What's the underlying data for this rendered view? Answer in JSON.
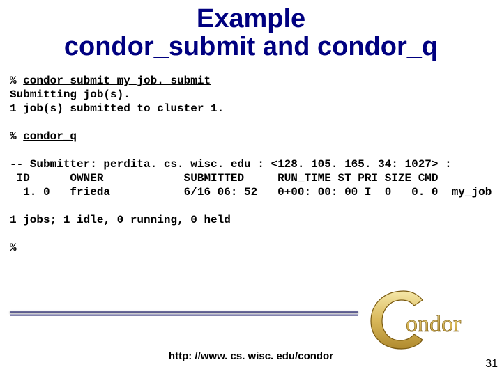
{
  "title_line1": "Example",
  "title_line2": "condor_submit and condor_q",
  "terminal": {
    "prompt1": "% ",
    "cmd1": "condor_submit my_job. submit",
    "out1a": "Submitting job(s).",
    "out1b": "1 job(s) submitted to cluster 1.",
    "prompt2": "% ",
    "cmd2": "condor_q",
    "submitter_line": "-- Submitter: perdita. cs. wisc. edu : <128. 105. 165. 34: 1027> :",
    "header": " ID      OWNER            SUBMITTED     RUN_TIME ST PRI SIZE CMD",
    "row": "  1. 0   frieda           6/16 06: 52   0+00: 00: 00 I  0   0. 0  my_job",
    "summary": "1 jobs; 1 idle, 0 running, 0 held",
    "prompt3": "%"
  },
  "footer_url": "http: //www. cs. wisc. edu/condor",
  "page_number": "31",
  "logo_text": "ondor"
}
